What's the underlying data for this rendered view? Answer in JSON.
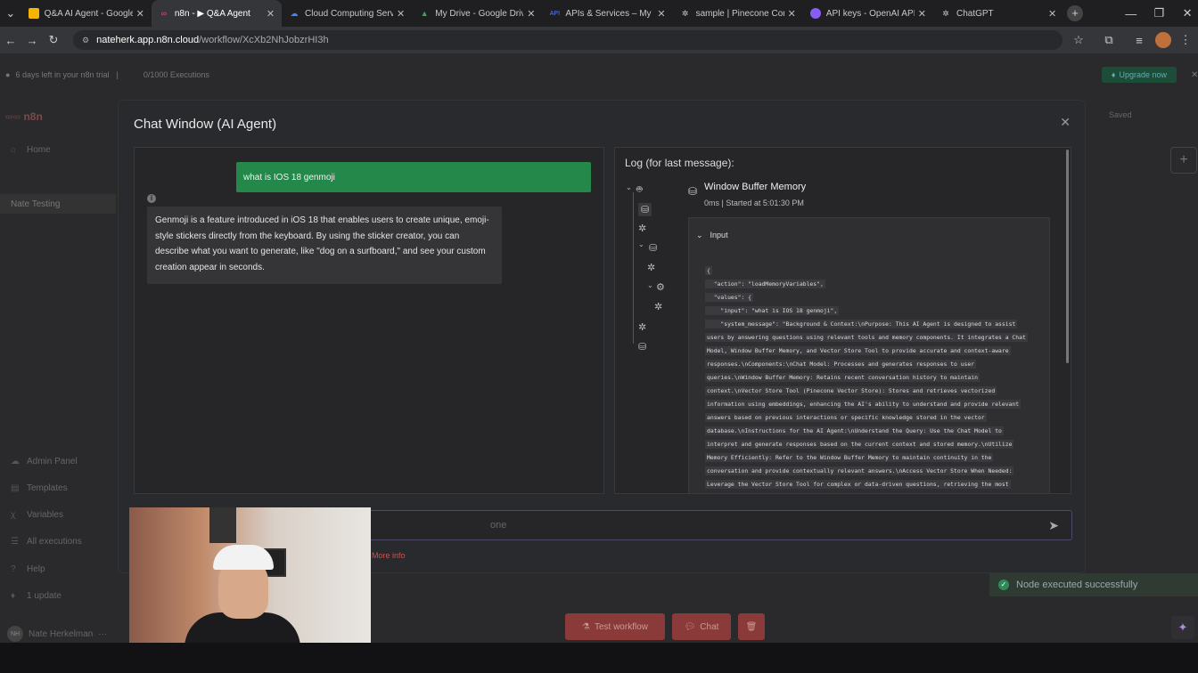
{
  "browser": {
    "tabs": [
      {
        "title": "Q&A AI Agent - Google S",
        "icon": "google-sheets-icon",
        "color": "#f4b400"
      },
      {
        "title": "n8n - ▶ Q&A Agent",
        "icon": "n8n-icon",
        "color": "#ea4b71"
      },
      {
        "title": "Cloud Computing Service",
        "icon": "google-cloud-icon",
        "color": "#4285f4"
      },
      {
        "title": "My Drive - Google Drive",
        "icon": "google-drive-icon",
        "color": "#34a853"
      },
      {
        "title": "APIs & Services – My First",
        "icon": "api-icon",
        "color": "#5c7cfa"
      },
      {
        "title": "sample | Pinecone Conso",
        "icon": "pinecone-icon",
        "color": "#cccccc"
      },
      {
        "title": "API keys - OpenAI API",
        "icon": "openai-icon",
        "color": "#8a5cf6"
      },
      {
        "title": "ChatGPT",
        "icon": "chatgpt-icon",
        "color": "#cccccc"
      }
    ],
    "url_host": "nateherk.app.n8n.cloud",
    "url_path": "/workflow/XcXb2NhJobzrHI3h"
  },
  "app": {
    "trial_text": "6 days left in your n8n trial",
    "executions_text": "0/1000 Executions",
    "upgrade_label": "Upgrade now",
    "logo_text": "n8n",
    "saved_label": "Saved",
    "sidebar": {
      "home": "Home",
      "project": "Nate Testing",
      "admin": "Admin Panel",
      "templates": "Templates",
      "variables": "Variables",
      "executions": "All executions",
      "help": "Help",
      "update": "1 update",
      "user": "Nate Herkelman",
      "user_initials": "NH"
    }
  },
  "modal": {
    "title": "Chat Window (AI Agent)",
    "user_message": "what is IOS 18 genmoji",
    "bot_message": "Genmoji is a feature introduced in iOS 18 that enables users to create unique, emoji-style stickers directly from the keyboard. By using the sticker creator, you can describe what you want to generate, like \"dog on a surfboard,\" and see your custom creation appear in seconds.",
    "log_title": "Log (for last message):",
    "node_name": "Window Buffer Memory",
    "node_meta": "0ms | Started at 5:01:30 PM",
    "input_label": "Input",
    "json_lines": [
      "{",
      "  \"action\": \"loadMemoryVariables\",",
      "  \"values\": {",
      "    \"input\": \"what is IOS 18 genmoji\",",
      "    \"system_message\": \"Background & Context:\\nPurpose: This AI Agent is designed to assist",
      "users by answering questions using relevant tools and memory components. It integrates a Chat",
      "Model, Window Buffer Memory, and Vector Store Tool to provide accurate and context-aware",
      "responses.\\nComponents:\\nChat Model: Processes and generates responses to user",
      "queries.\\nWindow Buffer Memory: Retains recent conversation history to maintain",
      "context.\\nVector Store Tool (Pinecone Vector Store): Stores and retrieves vectorized",
      "information using embeddings, enhancing the AI's ability to understand and provide relevant",
      "answers based on previous interactions or specific knowledge stored in the vector",
      "database.\\nInstructions for the AI Agent:\\nUnderstand the Query: Use the Chat Model to",
      "interpret and generate responses based on the current context and stored memory.\\nUtilize",
      "Memory Efficiently: Refer to the Window Buffer Memory to maintain continuity in the",
      "conversation and provide contextually relevant answers.\\nAccess Vector Store When Needed:",
      "Leverage the Vector Store Tool for complex or data-driven questions, retrieving the most"
    ],
    "input_placeholder": "one",
    "more_info": "More info"
  },
  "footer": {
    "toast": "Node executed successfully",
    "test_workflow": "Test workflow",
    "chat": "Chat"
  }
}
